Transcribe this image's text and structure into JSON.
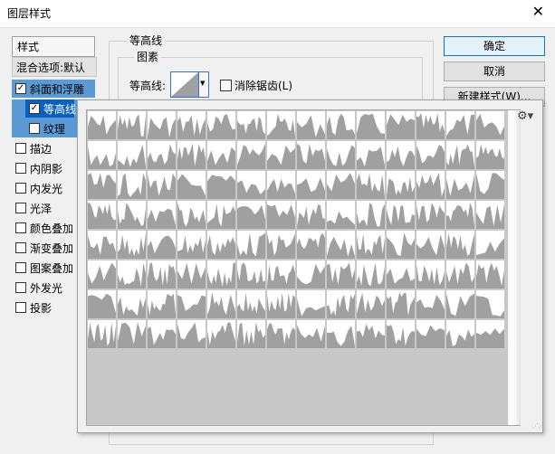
{
  "window": {
    "title": "图层样式",
    "close_label": "✕"
  },
  "left_list": {
    "header": "样式",
    "blend": "混合选项:默认",
    "items": [
      {
        "label": "斜面和浮雕",
        "checked": true
      },
      {
        "label": "等高线",
        "checked": true
      },
      {
        "label": "纹理",
        "checked": false
      },
      {
        "label": "描边",
        "checked": false
      },
      {
        "label": "内阴影",
        "checked": false
      },
      {
        "label": "内发光",
        "checked": false
      },
      {
        "label": "光泽",
        "checked": false
      },
      {
        "label": "颜色叠加",
        "checked": false
      },
      {
        "label": "渐变叠加",
        "checked": false
      },
      {
        "label": "图案叠加",
        "checked": false
      },
      {
        "label": "外发光",
        "checked": false
      },
      {
        "label": "投影",
        "checked": false
      }
    ]
  },
  "contour_section": {
    "title": "等高线",
    "elements_title": "图素",
    "contour_label": "等高线:",
    "antialias_label": "消除锯齿(L)",
    "antialias_checked": false
  },
  "buttons": {
    "ok": "确定",
    "cancel": "取消",
    "new_style": "新建样式(W)..."
  },
  "picker": {
    "rows": 8,
    "cols": 14,
    "fill_color": "#a0a0a0"
  }
}
